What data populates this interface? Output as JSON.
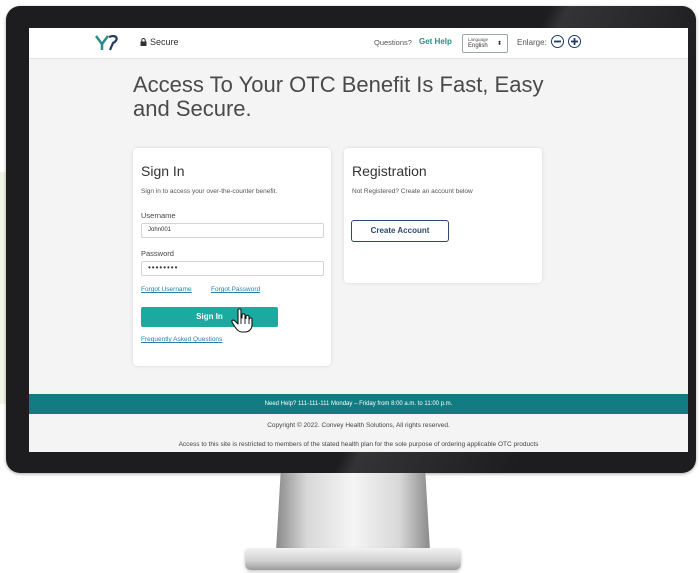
{
  "header": {
    "secure_label": "Secure",
    "questions_label": "Questions?",
    "get_help_label": "Get Help",
    "language_caption": "Language",
    "language_value": "English",
    "enlarge_label": "Enlarge:"
  },
  "headline": "Access To Your OTC Benefit Is Fast, Easy and Secure.",
  "signin": {
    "title": "Sign In",
    "subtitle": "Sign in to access your over-the-counter benefit.",
    "username_label": "Username",
    "username_value": "John001",
    "password_label": "Password",
    "password_value": "••••••••",
    "forgot_username": "Forgot Username",
    "forgot_password": "Forgot Password",
    "button_label": "Sign In",
    "faq_link": "Frequently Asked Questions"
  },
  "registration": {
    "title": "Registration",
    "subtitle": "Not Registered? Create an account below",
    "button_label": "Create Account"
  },
  "footer": {
    "help_text": "Need Help? 111-111-111   Monday – Friday from 8:00 a.m. to 11:00 p.m.",
    "copyright": "Copyright © 2022. Convey Health Solutions, All rights reserved.",
    "disclaimer": "Access to this site is restricted to members of the stated health plan for the sole purpose of ordering applicable OTC products"
  },
  "colors": {
    "accent_teal": "#1aaaa0",
    "footer_band": "#127c82",
    "navy": "#1f3a63",
    "link": "#2a7fa8"
  }
}
